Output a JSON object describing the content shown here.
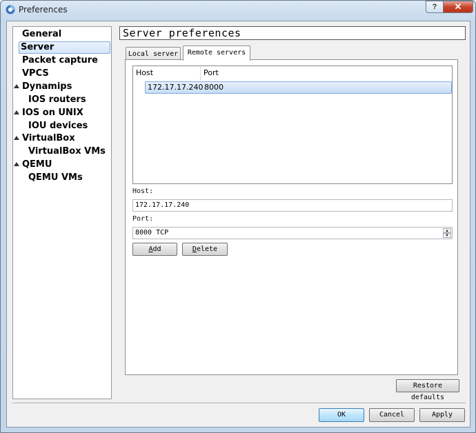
{
  "window": {
    "title": "Preferences",
    "help_label": "?",
    "close_label": "✕"
  },
  "sidebar": {
    "items": [
      {
        "label": "General",
        "level": 0,
        "expandable": false,
        "selected": false
      },
      {
        "label": "Server",
        "level": 0,
        "expandable": false,
        "selected": true
      },
      {
        "label": "Packet capture",
        "level": 0,
        "expandable": false,
        "selected": false
      },
      {
        "label": "VPCS",
        "level": 0,
        "expandable": false,
        "selected": false
      },
      {
        "label": "Dynamips",
        "level": 0,
        "expandable": true,
        "selected": false
      },
      {
        "label": "IOS routers",
        "level": 1,
        "expandable": false,
        "selected": false
      },
      {
        "label": "IOS on UNIX",
        "level": 0,
        "expandable": true,
        "selected": false
      },
      {
        "label": "IOU devices",
        "level": 1,
        "expandable": false,
        "selected": false
      },
      {
        "label": "VirtualBox",
        "level": 0,
        "expandable": true,
        "selected": false
      },
      {
        "label": "VirtualBox VMs",
        "level": 1,
        "expandable": false,
        "selected": false
      },
      {
        "label": "QEMU",
        "level": 0,
        "expandable": true,
        "selected": false
      },
      {
        "label": "QEMU VMs",
        "level": 1,
        "expandable": false,
        "selected": false
      }
    ]
  },
  "main": {
    "page_title": "Server preferences",
    "tabs": [
      {
        "label": "Local server",
        "active": false
      },
      {
        "label": "Remote servers",
        "active": true
      }
    ],
    "table": {
      "columns": [
        "Host",
        "Port"
      ],
      "rows": [
        {
          "host": "172.17.17.240",
          "port": "8000"
        }
      ]
    },
    "form": {
      "host_label": "Host:",
      "host_value": "172.17.17.240",
      "port_label": "Port:",
      "port_value": "8000 TCP",
      "add_prefix": "A",
      "add_rest": "dd",
      "delete_prefix": "D",
      "delete_rest": "elete"
    },
    "restore_defaults_label": "Restore defaults"
  },
  "dialog_buttons": {
    "ok": "OK",
    "cancel": "Cancel",
    "apply": "Apply"
  },
  "colors": {
    "selection": "#c7dcf6",
    "selection_border": "#84acdd",
    "close_button": "#c7462c"
  }
}
